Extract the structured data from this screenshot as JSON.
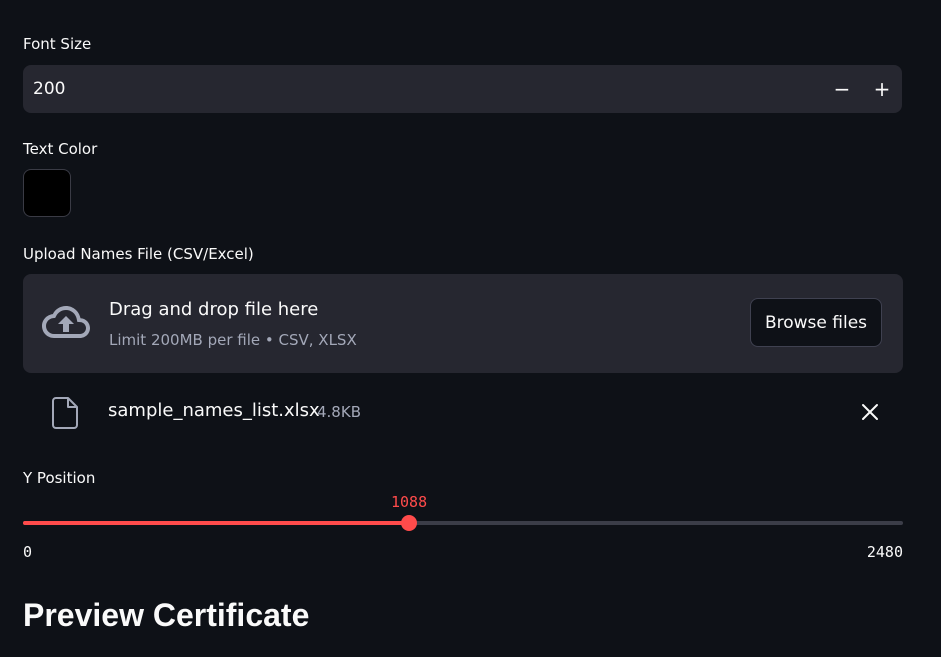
{
  "font_size": {
    "label": "Font Size",
    "value": "200",
    "decrement": "−",
    "increment": "+"
  },
  "text_color": {
    "label": "Text Color",
    "value": "#000000"
  },
  "uploader": {
    "label": "Upload Names File (CSV/Excel)",
    "drop_title": "Drag and drop file here",
    "drop_subtitle": "Limit 200MB per file • CSV, XLSX",
    "browse_label": "Browse files",
    "icon": "cloud-upload-icon",
    "file": {
      "icon": "file-icon",
      "name": "sample_names_list.xlsx",
      "size": "4.8KB",
      "remove_icon": "close-icon"
    }
  },
  "y_position": {
    "label": "Y Position",
    "value": 1088,
    "value_text": "1088",
    "min": 0,
    "min_text": "0",
    "max": 2480,
    "max_text": "2480",
    "accent": "#ff4b4b"
  },
  "preview": {
    "heading": "Preview Certificate"
  }
}
